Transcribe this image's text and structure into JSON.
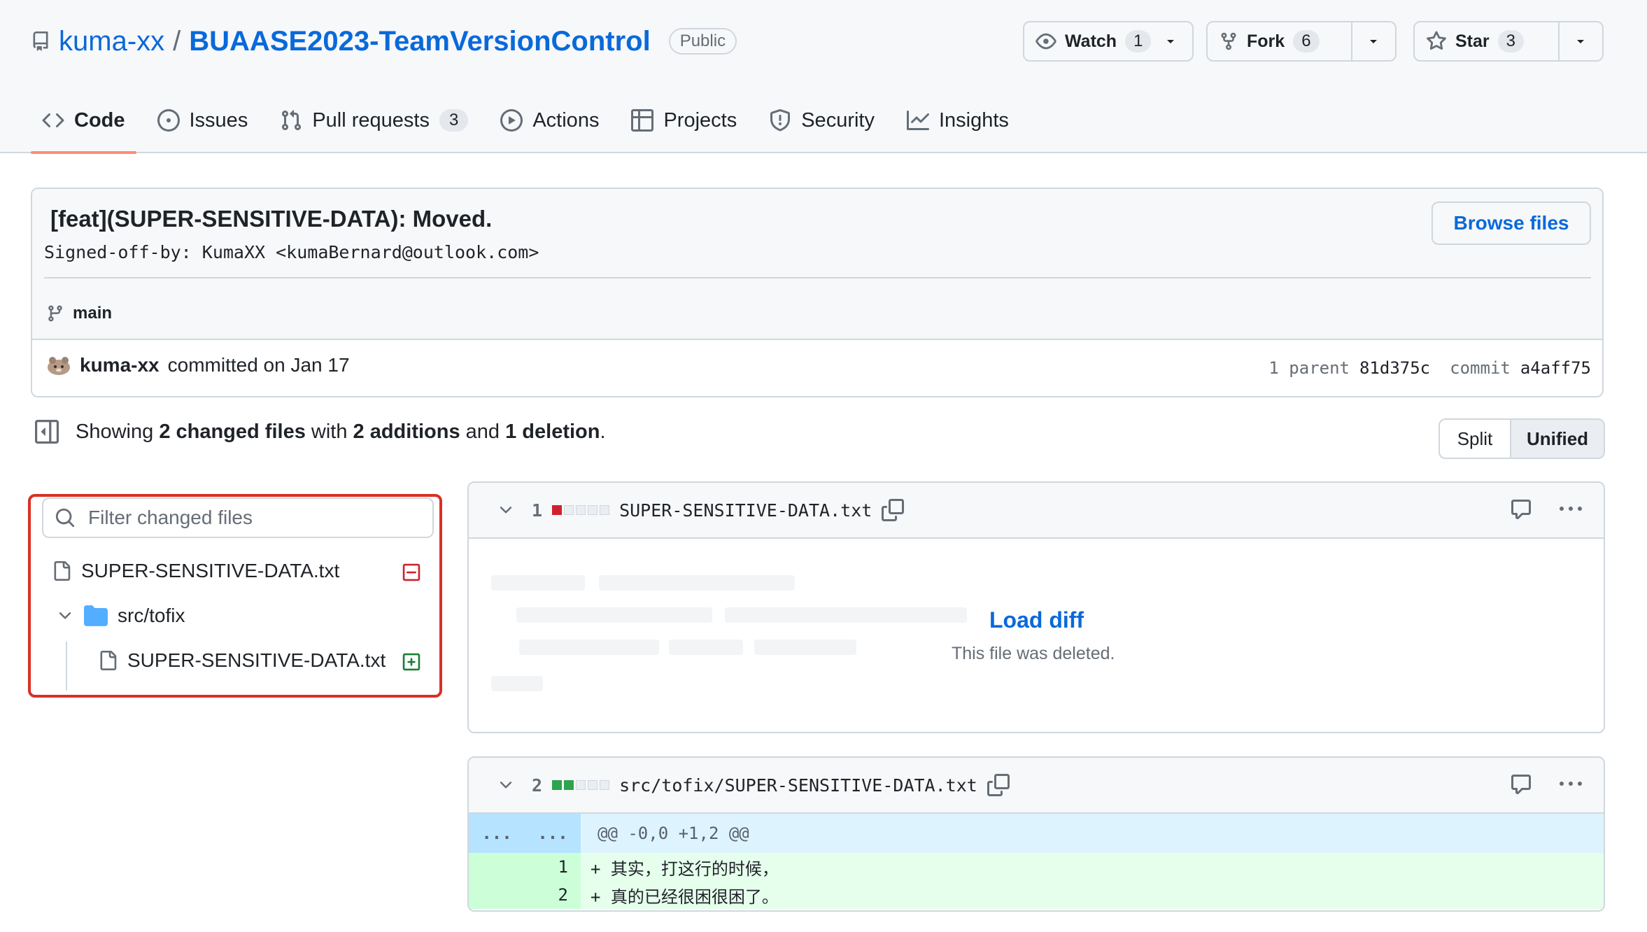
{
  "repo": {
    "owner": "kuma-xx",
    "separator": "/",
    "name": "BUAASE2023-TeamVersionControl",
    "visibility": "Public"
  },
  "actions": {
    "watch_label": "Watch",
    "watch_count": "1",
    "fork_label": "Fork",
    "fork_count": "6",
    "star_label": "Star",
    "star_count": "3"
  },
  "nav": {
    "code": "Code",
    "issues": "Issues",
    "pull_requests": "Pull requests",
    "pull_requests_count": "3",
    "actions": "Actions",
    "projects": "Projects",
    "security": "Security",
    "insights": "Insights"
  },
  "commit": {
    "title": "[feat](SUPER-SENSITIVE-DATA): Moved.",
    "description": "Signed-off-by: KumaXX <kumaBernard@outlook.com>",
    "branch": "main",
    "browse_label": "Browse files",
    "author": "kuma-xx",
    "committed_text": "committed on Jan 17",
    "parent_label": "1 parent",
    "parent_sha": "81d375c",
    "commit_label": "commit",
    "commit_sha": "a4aff75"
  },
  "summary": {
    "showing": "Showing",
    "files_changed": "2 changed files",
    "with": "with",
    "additions": "2 additions",
    "and": "and",
    "deletions": "1 deletion",
    "period": ".",
    "split_label": "Split",
    "unified_label": "Unified"
  },
  "file_tree": {
    "filter_placeholder": "Filter changed files",
    "items": [
      {
        "name": "SUPER-SENSITIVE-DATA.txt",
        "status": "deleted"
      },
      {
        "name": "src/tofix",
        "type": "folder"
      },
      {
        "name": "SUPER-SENSITIVE-DATA.txt",
        "status": "added"
      }
    ]
  },
  "diffs": [
    {
      "number": "1",
      "path": "SUPER-SENSITIVE-DATA.txt",
      "load_label": "Load diff",
      "note": "This file was deleted."
    },
    {
      "number": "2",
      "path": "src/tofix/SUPER-SENSITIVE-DATA.txt",
      "hunk_left": "...",
      "hunk_right": "...",
      "hunk_header": "@@ -0,0 +1,2 @@",
      "lines": [
        {
          "num": "1",
          "text": "+ 其实，打这行的时候，"
        },
        {
          "num": "2",
          "text": "+ 真的已经很困很困了。"
        }
      ]
    }
  ],
  "colors": {
    "link": "#0969da",
    "nav_underline": "#fd8c73",
    "highlight_border": "#d93025",
    "deleted": "#cf222e",
    "added": "#2da44e"
  }
}
